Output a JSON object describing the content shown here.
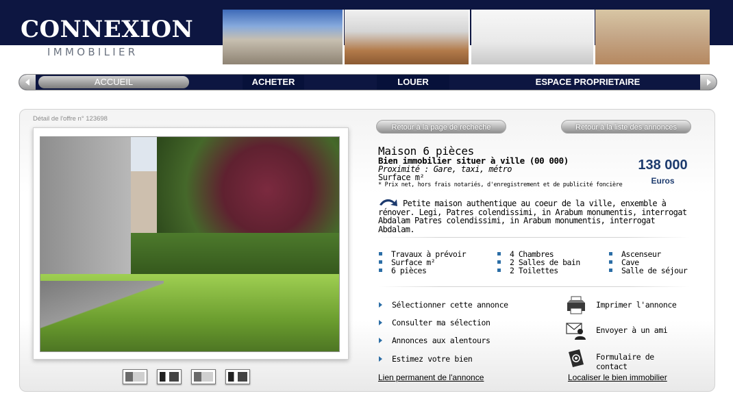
{
  "header": {
    "logo_title": "CONNEXION",
    "logo_subtitle": "IMMOBILIER",
    "banner_photos": [
      "city-square-photo",
      "meeting-photo",
      "building-entrance-photo",
      "team-work-photo"
    ]
  },
  "nav": {
    "items": [
      {
        "label": "ACCUEIL"
      },
      {
        "label": "ACHETER"
      },
      {
        "label": "LOUER"
      },
      {
        "label": "ESPACE PROPRIETAIRE"
      }
    ]
  },
  "offer": {
    "detail_label": "Détail de l'offre n° 123698",
    "back_search_label": "Retour à la page de recheche",
    "back_list_label": "Retour à la liste des annonces",
    "title": "Maison 6 pièces",
    "subtitle": "Bien immobilier situer à ville (00 000)",
    "proximity": "Proximité : Gare, taxi, métro",
    "surface": "Surface m²",
    "note": "* Prix net, hors frais notariés, d'enregistrement et de publicité foncière",
    "price": "138 000",
    "price_unit": "Euros",
    "description": "Petite maison authentique au coeur de la ville, enxemble à rénover. Legi, Patres colendissimi, in Arabum monumentis, interrogat  Abdalam Patres colendissimi, in Arabum monumentis, interrogat  Abdalam.",
    "features_col1": [
      "Travaux à prévoir",
      "Surface m²",
      "6 pièces"
    ],
    "features_col2": [
      "4 Chambres",
      "2 Salles de bain",
      "2 Toilettes"
    ],
    "features_col3": [
      "Ascenseur",
      "Cave",
      "Salle de séjour"
    ],
    "actions": [
      "Sélectionner cette annonce",
      "Consulter ma sélection",
      "Annonces aux alentours",
      "Estimez votre bien"
    ],
    "tools": [
      {
        "label": "Imprimer l'annonce",
        "icon": "printer-icon"
      },
      {
        "label": "Envoyer à un ami",
        "icon": "mail-user-icon"
      },
      {
        "label": "Formulaire de contact",
        "icon": "at-sign-icon"
      }
    ],
    "permanent_link": "Lien permanent de l'annonce",
    "locate_link": "Localiser le bien immobilier",
    "thumbnail_count": 4
  },
  "colors": {
    "brand_navy": "#0d1641",
    "accent_blue": "#1d3b6e",
    "bullet_blue": "#2c6ea6"
  }
}
